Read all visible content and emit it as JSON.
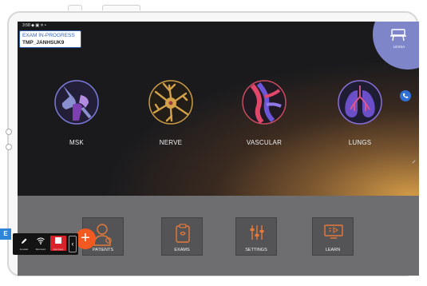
{
  "status_bar": {
    "time": "3:58 ◆ ▣ ✕ •",
    "system_icons": "✓ ⇅ ▮"
  },
  "exam": {
    "status": "EXAM IN-PROGRESS",
    "patient_id": "TMP_JANHSUK9"
  },
  "user": {
    "label": "LEXSA"
  },
  "presets": [
    {
      "label": "MSK",
      "icon": "msk-knee-icon"
    },
    {
      "label": "NERVE",
      "icon": "nerve-cell-icon"
    },
    {
      "label": "VASCULAR",
      "icon": "vascular-vessel-icon"
    },
    {
      "label": "LUNGS",
      "icon": "lungs-icon"
    }
  ],
  "bottom_nav": {
    "patients": "PATIENTS",
    "exams": "EXAMS",
    "settings": "SETTINGS",
    "learn": "LEARN"
  },
  "fab": {
    "symbol": "+"
  },
  "badge": {
    "letter": "E"
  },
  "toolbar": {
    "annotate": "Annotate",
    "reconnect": "Reconnect",
    "stop_exam": "Stop Exam",
    "collapse": "‹"
  },
  "colors": {
    "accent_blue": "#3568c2",
    "fab_orange": "#f25a21",
    "user_purple": "#7f85c9",
    "stop_red": "#d9232b"
  }
}
